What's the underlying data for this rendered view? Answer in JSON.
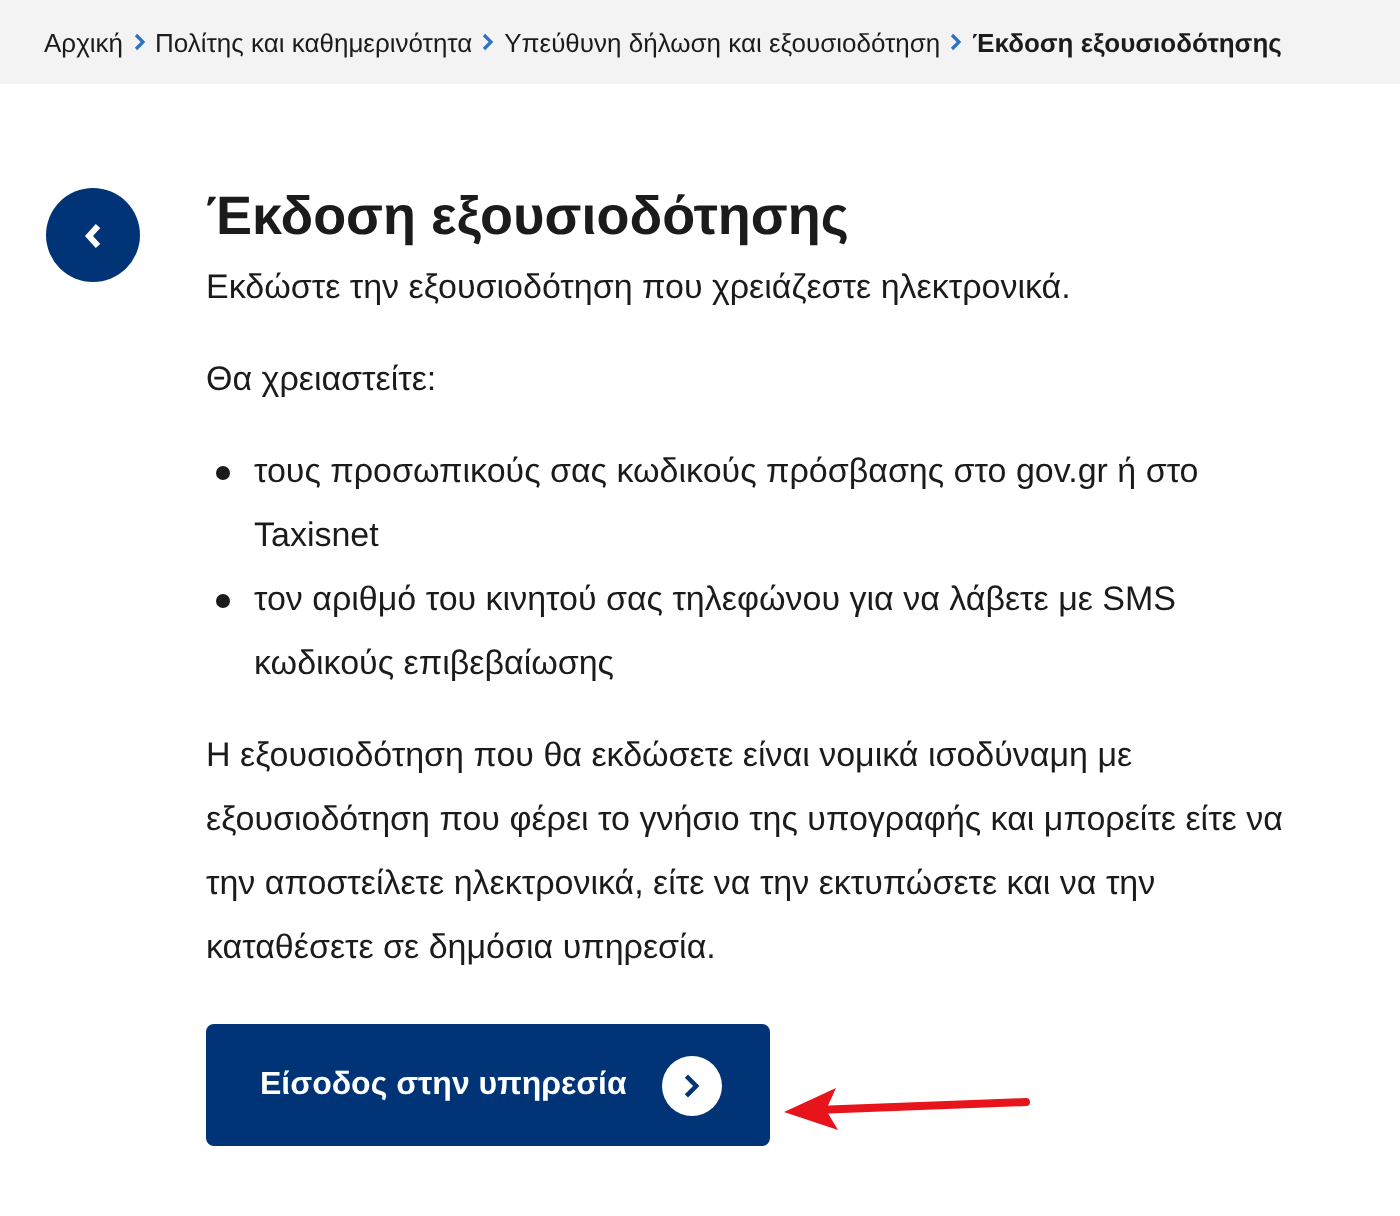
{
  "breadcrumb": [
    {
      "label": "Αρχική",
      "current": false
    },
    {
      "label": "Πολίτης και καθημερινότητα",
      "current": false
    },
    {
      "label": "Υπεύθυνη δήλωση και εξουσιοδότηση",
      "current": false
    },
    {
      "label": "Έκδοση εξουσιοδότησης",
      "current": true
    }
  ],
  "title": "Έκδοση εξουσιοδότησης",
  "subtitle": "Εκδώστε την εξουσιοδότηση που χρειάζεστε ηλεκτρονικά.",
  "needs_heading": "Θα χρειαστείτε:",
  "needs": [
    "τους προσωπικούς σας κωδικούς πρόσβασης στο gov.gr ή στο Taxisnet",
    "τον αριθμό του κινητού σας τηλεφώνου για να λάβετε με SMS κωδικούς επιβεβαίωσης"
  ],
  "paragraph": "Η εξουσιοδότηση που θα εκδώσετε είναι νομικά ισοδύναμη με εξουσιοδότηση που φέρει το γνήσιο της υπογραφής και μπορείτε είτε να την αποστείλετε ηλεκτρονικά, είτε να την εκτυπώσετε και να την καταθέσετε σε δημόσια υπηρεσία.",
  "start_button": {
    "label": "Είσοδος στην υπηρεσία"
  }
}
